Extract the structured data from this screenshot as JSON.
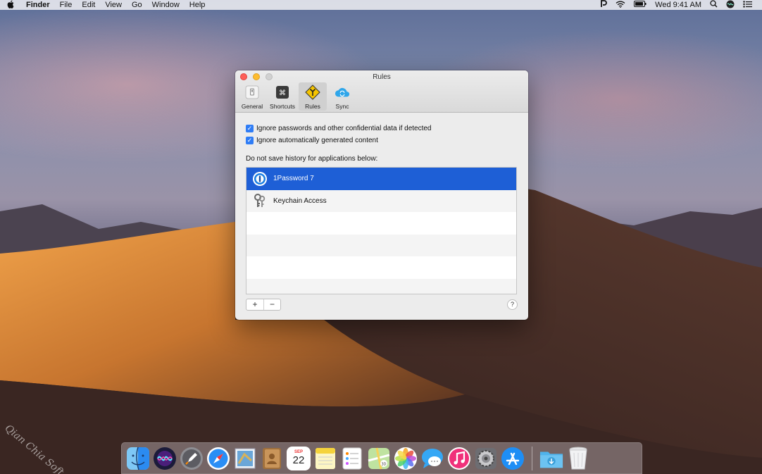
{
  "menubar": {
    "app_name": "Finder",
    "menus": [
      "File",
      "Edit",
      "View",
      "Go",
      "Window",
      "Help"
    ],
    "clock": "Wed 9:41 AM"
  },
  "window": {
    "title": "Rules",
    "toolbar": {
      "general": "General",
      "shortcuts": "Shortcuts",
      "rules": "Rules",
      "sync": "Sync"
    },
    "options": {
      "ignore_passwords": "Ignore passwords and other confidential data if detected",
      "ignore_generated": "Ignore automatically generated content"
    },
    "list_label": "Do not save history for applications below:",
    "apps": [
      {
        "name": "1Password 7",
        "icon": "1password-icon",
        "selected": true
      },
      {
        "name": "Keychain Access",
        "icon": "keychain-icon",
        "selected": false
      }
    ],
    "add_label": "+",
    "remove_label": "−",
    "help_label": "?"
  },
  "dock": {
    "calendar_month": "SEP",
    "calendar_day": "22",
    "apps": [
      "finder-icon",
      "siri-icon",
      "launchpad-icon",
      "safari-icon",
      "mail-icon",
      "contacts-icon",
      "calendar-icon",
      "notes-icon",
      "reminders-icon",
      "maps-icon",
      "photos-icon",
      "messages-icon",
      "itunes-icon",
      "system-preferences-icon",
      "app-store-icon",
      "downloads-folder-icon",
      "trash-icon"
    ]
  },
  "watermark": "Qian Chia Soft",
  "colors": {
    "selection": "#1e5fd6",
    "checkbox": "#2f7df6",
    "close": "#fd5f57",
    "minimize": "#febc2e"
  }
}
